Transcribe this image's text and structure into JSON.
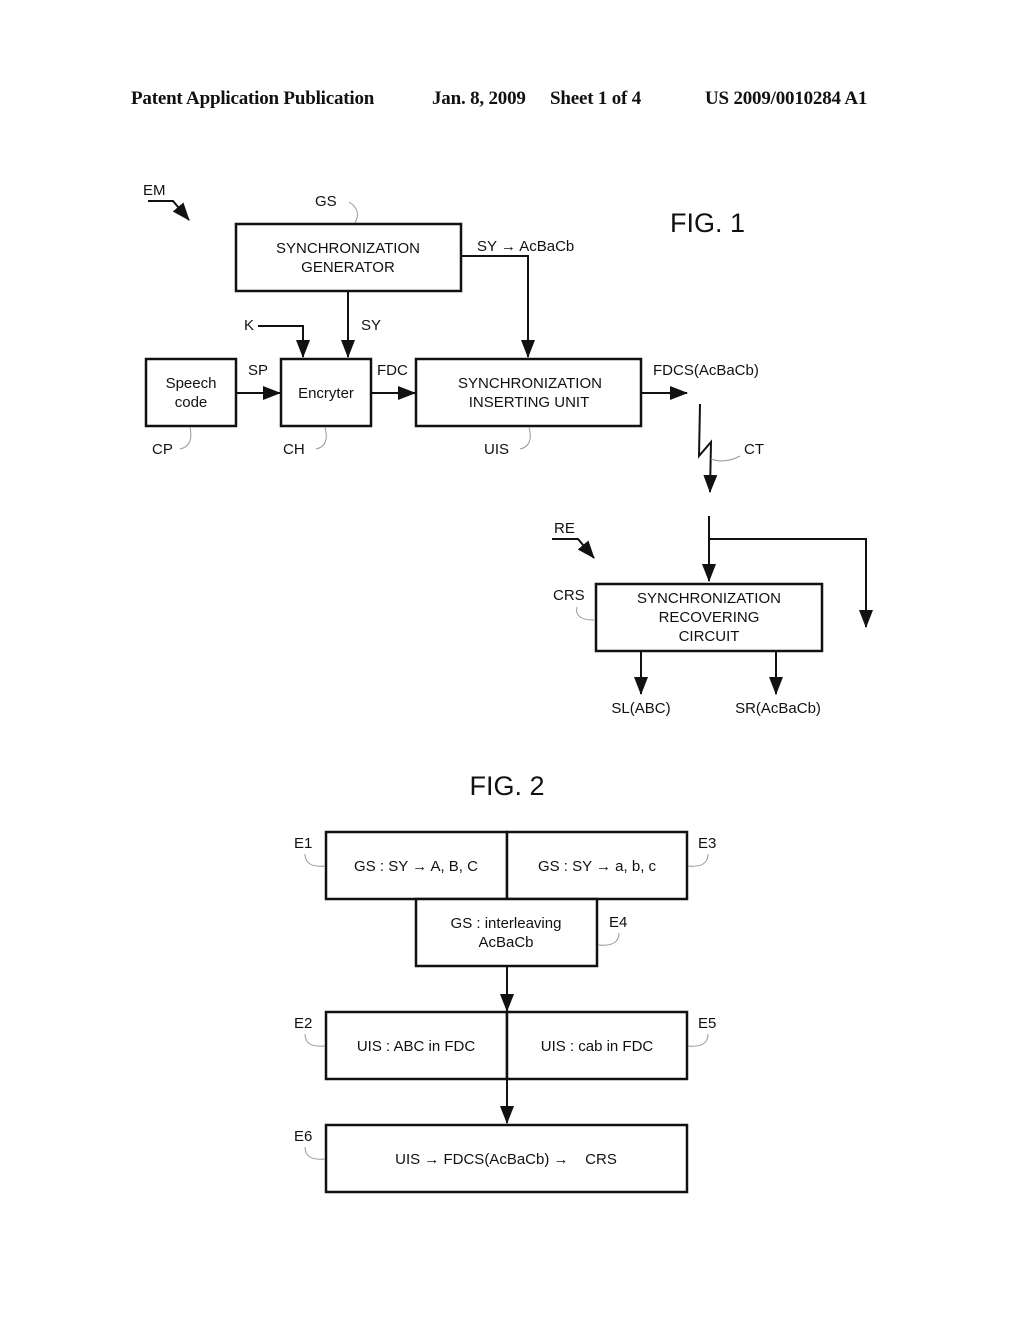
{
  "header": {
    "publication": "Patent Application Publication",
    "date": "Jan. 8, 2009",
    "sheet": "Sheet 1 of 4",
    "number": "US 2009/0010284 A1"
  },
  "fig1": {
    "title": "FIG. 1",
    "emitter_ref": "EM",
    "receiver_ref": "RE",
    "gs": {
      "ref": "GS",
      "line1": "SYNCHRONIZATION",
      "line2": "GENERATOR"
    },
    "gs_output": "SY → AcBaCb",
    "key_label": "K",
    "sy_label": "SY",
    "speech": {
      "ref": "CP",
      "line1": "Speech",
      "line2": "code"
    },
    "sp_label": "SP",
    "encrypter": {
      "ref": "CH",
      "label": "Encryter"
    },
    "fdc_label": "FDC",
    "uis": {
      "ref": "UIS",
      "line1": "SYNCHRONIZATION",
      "line2": "INSERTING UNIT"
    },
    "fdcs_label": "FDCS(AcBaCb)",
    "channel_ref": "CT",
    "crs": {
      "ref": "CRS",
      "line1": "SYNCHRONIZATION",
      "line2": "RECOVERING",
      "line3": "CIRCUIT"
    },
    "sl_label": "SL(ABC)",
    "sr_label": "SR(AcBaCb)"
  },
  "fig2": {
    "title": "FIG. 2",
    "steps": {
      "e1": {
        "ref": "E1",
        "text": "GS : SY → A, B, C"
      },
      "e3": {
        "ref": "E3",
        "text": "GS : SY → a, b, c"
      },
      "e4": {
        "ref": "E4",
        "line1": "GS : interleaving",
        "line2": "AcBaCb"
      },
      "e2": {
        "ref": "E2",
        "text": "UIS : ABC in FDC"
      },
      "e5": {
        "ref": "E5",
        "text": "UIS : cab in FDC"
      },
      "e6": {
        "ref": "E6",
        "text": "UIS → FDCS(AcBaCb) →    CRS"
      }
    }
  }
}
